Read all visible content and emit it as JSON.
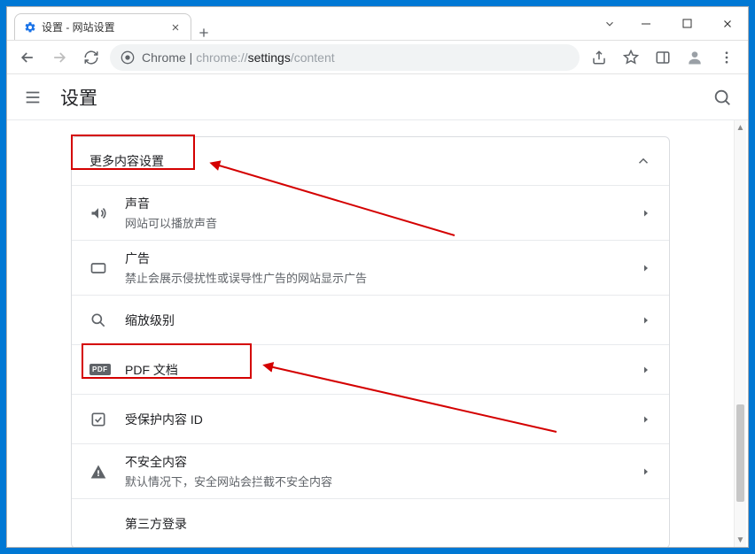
{
  "window": {
    "tab_title": "设置 - 网站设置"
  },
  "toolbar": {
    "url_prefix": "Chrome",
    "url_sep": " | ",
    "url_muted": "chrome://",
    "url_dark": "settings",
    "url_tail": "/content"
  },
  "header": {
    "title": "设置"
  },
  "section": {
    "title": "更多内容设置"
  },
  "rows": [
    {
      "icon": "sound",
      "title": "声音",
      "subtitle": "网站可以播放声音"
    },
    {
      "icon": "ads",
      "title": "广告",
      "subtitle": "禁止会展示侵扰性或误导性广告的网站显示广告"
    },
    {
      "icon": "zoom",
      "title": "缩放级别",
      "subtitle": ""
    },
    {
      "icon": "pdf",
      "title": "PDF 文档",
      "subtitle": ""
    },
    {
      "icon": "protect",
      "title": "受保护内容 ID",
      "subtitle": ""
    },
    {
      "icon": "warn",
      "title": "不安全内容",
      "subtitle": "默认情况下，安全网站会拦截不安全内容"
    },
    {
      "icon": "third",
      "title": "第三方登录",
      "subtitle": ""
    }
  ]
}
